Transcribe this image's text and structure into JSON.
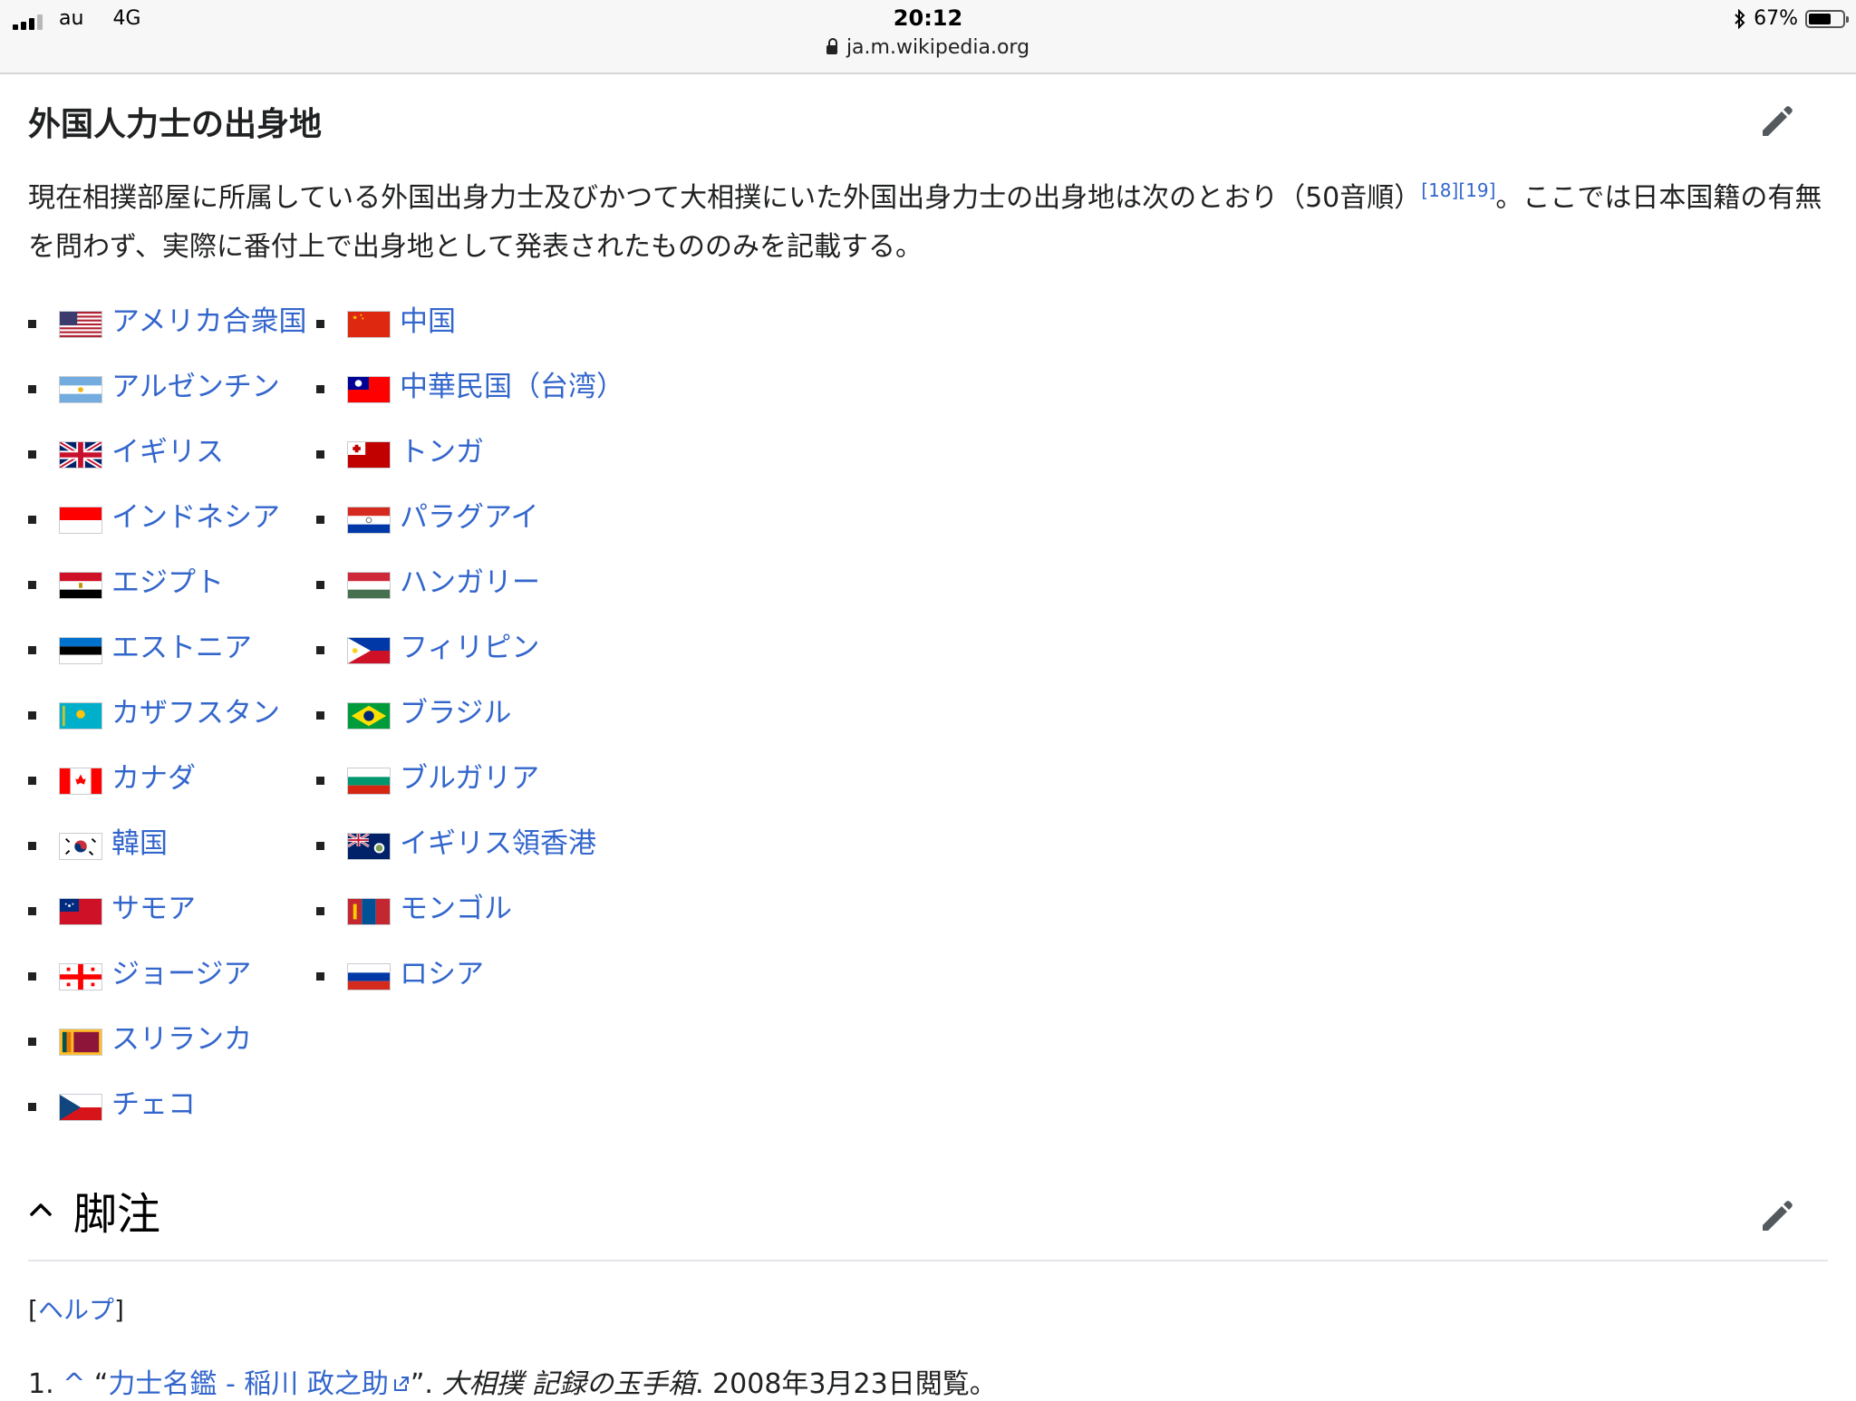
{
  "status_bar": {
    "carrier": "au",
    "network": "4G",
    "time": "20:12",
    "url": "ja.m.wikipedia.org",
    "battery_percent": "67%",
    "battery_level": 0.67
  },
  "section": {
    "title": "外国人力士の出身地",
    "intro_text": "現在相撲部屋に所属している外国出身力士及びかつて大相撲にいた外国出身力士の出身地は次のとおり（50音順）",
    "intro_refs": "[18][19]",
    "intro_text2": "。ここでは日本国籍の有無を問わず、実際に番付上で出身地として発表されたもののみを記載する。"
  },
  "countries_col1": [
    {
      "name": "アメリカ合衆国",
      "flag": "us-flag"
    },
    {
      "name": "アルゼンチン",
      "flag": "argentina-flag"
    },
    {
      "name": "イギリス",
      "flag": "uk-flag"
    },
    {
      "name": "インドネシア",
      "flag": "indonesia-flag"
    },
    {
      "name": "エジプト",
      "flag": "egypt-flag"
    },
    {
      "name": "エストニア",
      "flag": "estonia-flag"
    },
    {
      "name": "カザフスタン",
      "flag": "kazakhstan-flag"
    },
    {
      "name": "カナダ",
      "flag": "canada-flag"
    },
    {
      "name": "韓国",
      "flag": "korea-flag"
    },
    {
      "name": "サモア",
      "flag": "samoa-flag"
    },
    {
      "name": "ジョージア",
      "flag": "georgia-flag"
    },
    {
      "name": "スリランカ",
      "flag": "sri-lanka-flag"
    },
    {
      "name": "チェコ",
      "flag": "czech-flag"
    }
  ],
  "countries_col2": [
    {
      "name": "中国",
      "flag": "china-flag"
    },
    {
      "name": "中華民国（台湾）",
      "flag": "taiwan-flag"
    },
    {
      "name": "トンガ",
      "flag": "tonga-flag"
    },
    {
      "name": "パラグアイ",
      "flag": "paraguay-flag"
    },
    {
      "name": "ハンガリー",
      "flag": "hungary-flag"
    },
    {
      "name": "フィリピン",
      "flag": "philippines-flag"
    },
    {
      "name": "ブラジル",
      "flag": "brazil-flag"
    },
    {
      "name": "ブルガリア",
      "flag": "bulgaria-flag"
    },
    {
      "name": "イギリス領香港",
      "flag": "hong-kong-flag"
    },
    {
      "name": "モンゴル",
      "flag": "mongolia-flag"
    },
    {
      "name": "ロシア",
      "flag": "russia-flag"
    }
  ],
  "footnotes": {
    "title": "脚注",
    "help_open": "[",
    "help_label": "ヘルプ",
    "help_close": "]",
    "ref1_number": "1.",
    "ref1_caret": "^",
    "ref1_quote_open": "“",
    "ref1_link": "力士名鑑 - 稲川 政之助",
    "ref1_quote_close": "”. ",
    "ref1_source": "大相撲 記録の玉手箱",
    "ref1_date": ". 2008年3月23日閲覧。"
  },
  "colors": {
    "link": "#3366cc",
    "text": "#202122",
    "divider": "#e3e5e8"
  }
}
